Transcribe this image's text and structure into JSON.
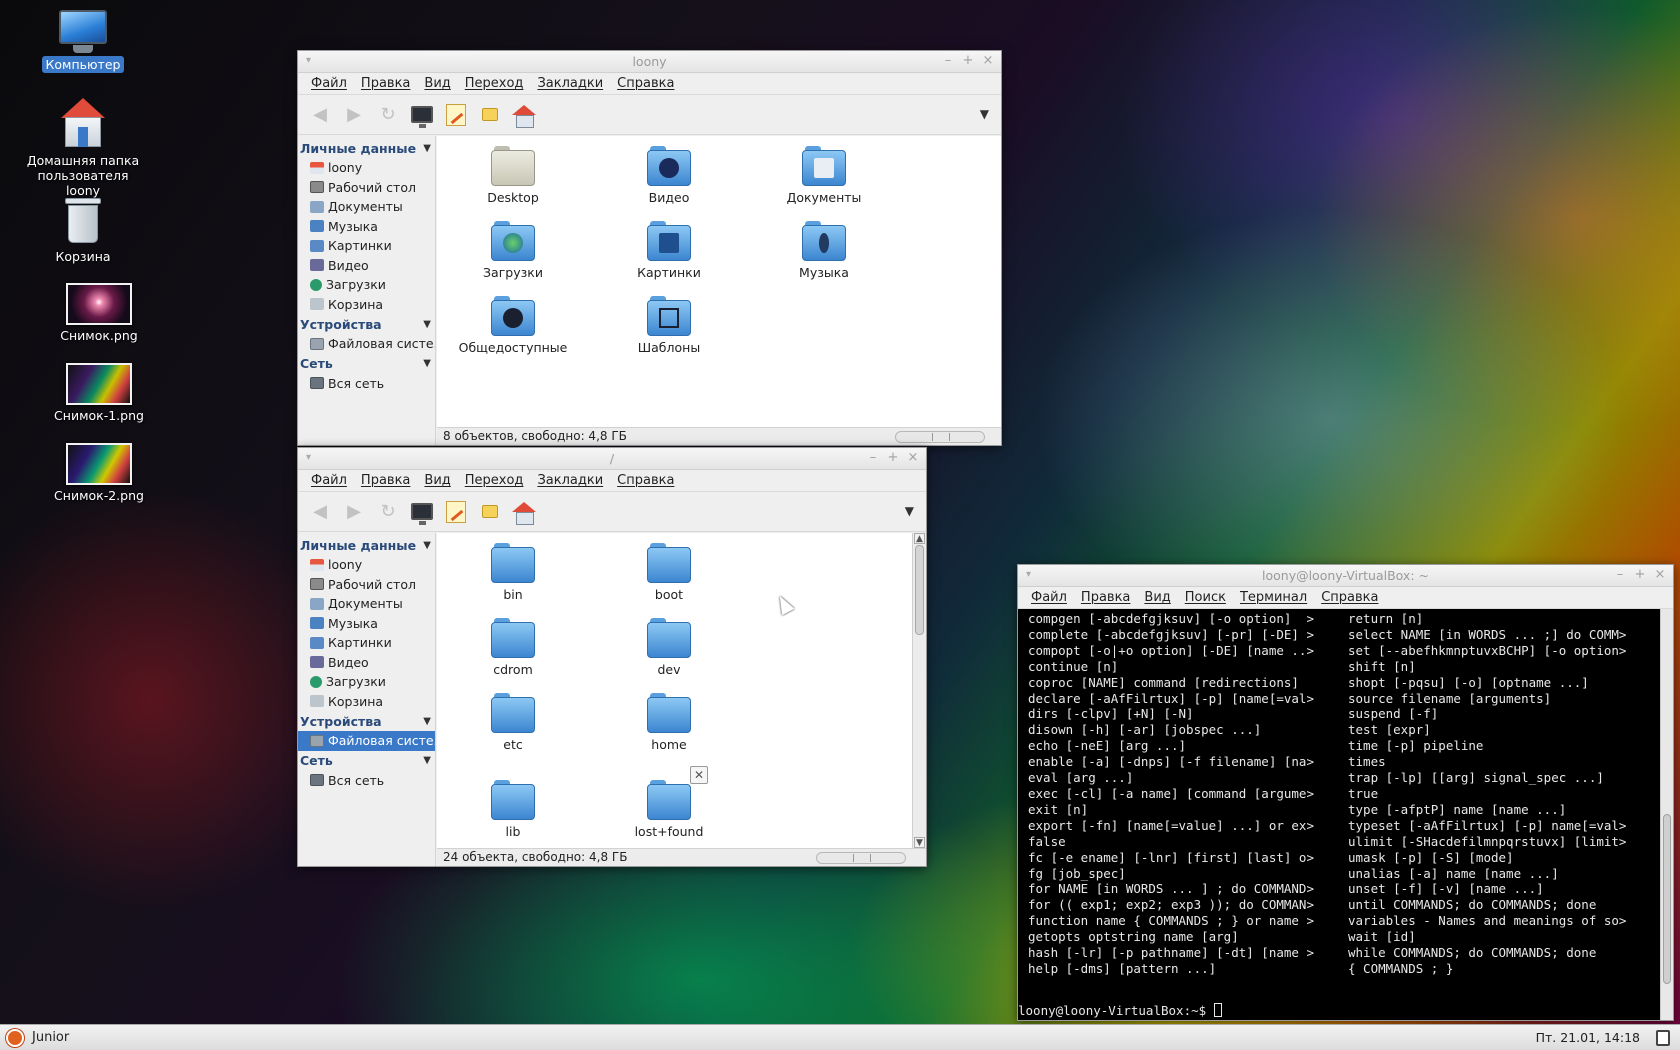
{
  "desktop": {
    "icons": [
      {
        "label": "Компьютер",
        "icon": "computer-icon"
      },
      {
        "label": "Домашняя папка пользователя loony",
        "icon": "home-folder-icon"
      },
      {
        "label": "Корзина",
        "icon": "trash-icon"
      },
      {
        "label": "Снимок.png",
        "icon": "image-thumbnail-icon"
      },
      {
        "label": "Снимок-1.png",
        "icon": "image-thumbnail-icon"
      },
      {
        "label": "Снимок-2.png",
        "icon": "image-thumbnail-icon"
      }
    ]
  },
  "fm_menu": [
    "Файл",
    "Правка",
    "Вид",
    "Переход",
    "Закладки",
    "Справка"
  ],
  "sidebar": {
    "personal_header": "Личные данные",
    "personal_items": [
      "loony",
      "Рабочий стол",
      "Документы",
      "Музыка",
      "Картинки",
      "Видео",
      "Загрузки",
      "Корзина"
    ],
    "devices_header": "Устройства",
    "devices_items": [
      "Файловая систе..."
    ],
    "network_header": "Сеть",
    "network_items": [
      "Вся сеть"
    ]
  },
  "window_home": {
    "title": "loony",
    "items": [
      "Desktop",
      "Видео",
      "Документы",
      "Загрузки",
      "Картинки",
      "Музыка",
      "Общедоступные",
      "Шаблоны"
    ],
    "status": "8 объектов, свободно: 4,8 ГБ"
  },
  "window_root": {
    "title": "/",
    "items": [
      "bin",
      "boot",
      "cdrom",
      "dev",
      "etc",
      "home",
      "lib",
      "lost+found"
    ],
    "status": "24 объекта, свободно: 4,8 ГБ"
  },
  "terminal": {
    "title": "loony@loony-VirtualBox: ~",
    "menu": [
      "Файл",
      "Правка",
      "Вид",
      "Поиск",
      "Терминал",
      "Справка"
    ],
    "left_lines": [
      "compgen [-abcdefgjksuv] [-o option]  >",
      "complete [-abcdefgjksuv] [-pr] [-DE] >",
      "compopt [-o|+o option] [-DE] [name ..>",
      "continue [n]",
      "coproc [NAME] command [redirections]",
      "declare [-aAfFilrtux] [-p] [name[=val>",
      "dirs [-clpv] [+N] [-N]",
      "disown [-h] [-ar] [jobspec ...]",
      "echo [-neE] [arg ...]",
      "enable [-a] [-dnps] [-f filename] [na>",
      "eval [arg ...]",
      "exec [-cl] [-a name] [command [argume>",
      "exit [n]",
      "export [-fn] [name[=value] ...] or ex>",
      "false",
      "fc [-e ename] [-lnr] [first] [last] o>",
      "fg [job_spec]",
      "for NAME [in WORDS ... ] ; do COMMAND>",
      "for (( exp1; exp2; exp3 )); do COMMAN>",
      "function name { COMMANDS ; } or name >",
      "getopts optstring name [arg]",
      "hash [-lr] [-p pathname] [-dt] [name >",
      "help [-dms] [pattern ...]"
    ],
    "right_lines": [
      "return [n]",
      "select NAME [in WORDS ... ;] do COMM>",
      "set [--abefhkmnptuvxBCHP] [-o option>",
      "shift [n]",
      "shopt [-pqsu] [-o] [optname ...]",
      "source filename [arguments]",
      "suspend [-f]",
      "test [expr]",
      "time [-p] pipeline",
      "times",
      "trap [-lp] [[arg] signal_spec ...]",
      "true",
      "type [-afptP] name [name ...]",
      "typeset [-aAfFilrtux] [-p] name[=val>",
      "ulimit [-SHacdefilmnpqrstuvx] [limit>",
      "umask [-p] [-S] [mode]",
      "unalias [-a] name [name ...]",
      "unset [-f] [-v] [name ...]",
      "until COMMANDS; do COMMANDS; done",
      "variables - Names and meanings of so>",
      "wait [id]",
      "while COMMANDS; do COMMANDS; done",
      "{ COMMANDS ; }"
    ],
    "prompt": "loony@loony-VirtualBox:~$ "
  },
  "panel": {
    "label": "Junior",
    "clock": "Пт. 21.01, 14:18"
  },
  "colors": {
    "selection": "#3a78c8",
    "sidebar_header": "#2a4a7a",
    "terminal_bg": "#000000",
    "terminal_fg": "#e8e8e8"
  }
}
